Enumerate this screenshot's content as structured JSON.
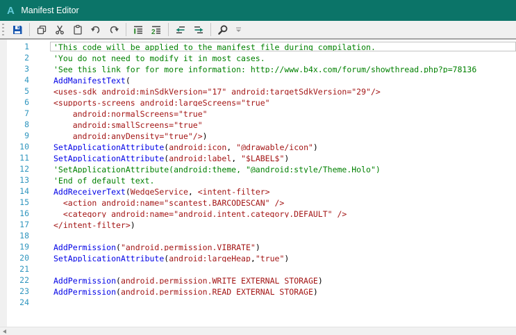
{
  "titlebar": {
    "logo": "A",
    "title": "Manifest Editor",
    "bg_color": "#0b7468",
    "logo_color": "#62cbd8"
  },
  "toolbar": {
    "items": [
      {
        "type": "grip",
        "name": "toolbar-grip"
      },
      {
        "type": "button",
        "name": "save-button",
        "icon": "save-icon"
      },
      {
        "type": "separator"
      },
      {
        "type": "button",
        "name": "copy-button",
        "icon": "copy-icon"
      },
      {
        "type": "button",
        "name": "cut-button",
        "icon": "cut-icon"
      },
      {
        "type": "button",
        "name": "paste-button",
        "icon": "paste-icon"
      },
      {
        "type": "button",
        "name": "undo-button",
        "icon": "undo-icon"
      },
      {
        "type": "button",
        "name": "redo-button",
        "icon": "redo-icon"
      },
      {
        "type": "separator"
      },
      {
        "type": "button",
        "name": "comment-button",
        "icon": "comment-icon"
      },
      {
        "type": "button",
        "name": "uncomment-button",
        "icon": "uncomment-icon"
      },
      {
        "type": "separator"
      },
      {
        "type": "button",
        "name": "outdent-button",
        "icon": "outdent-icon"
      },
      {
        "type": "button",
        "name": "indent-button",
        "icon": "indent-icon"
      },
      {
        "type": "separator"
      },
      {
        "type": "button",
        "name": "find-button",
        "icon": "search-icon"
      },
      {
        "type": "overflow",
        "name": "toolbar-overflow-button",
        "icon": "chevron-down-icon"
      }
    ]
  },
  "editor": {
    "colors": {
      "com": "#008000",
      "kw": "#0000e6",
      "str": "#a31515",
      "pl": "#000000",
      "line_number": "#2e95be",
      "current_line_border": "#c3c3c3"
    },
    "lines": [
      {
        "n": 1,
        "current": true,
        "seg": [
          {
            "t": "'This code will be applied to the manifest file during compilation.",
            "c": "com"
          }
        ]
      },
      {
        "n": 2,
        "seg": [
          {
            "t": "'You do not need to modify it in most cases.",
            "c": "com"
          }
        ]
      },
      {
        "n": 3,
        "seg": [
          {
            "t": "'See this link for for more information: http://www.b4x.com/forum/showthread.php?p=78136",
            "c": "com"
          }
        ]
      },
      {
        "n": 4,
        "seg": [
          {
            "t": "AddManifestText",
            "c": "kw"
          },
          {
            "t": "(",
            "c": "pl"
          }
        ]
      },
      {
        "n": 5,
        "seg": [
          {
            "t": "<uses-sdk android:minSdkVersion=\"17\" android:targetSdkVersion=\"29\"/>",
            "c": "str"
          }
        ]
      },
      {
        "n": 6,
        "seg": [
          {
            "t": "<supports-screens android:largeScreens=\"true\"",
            "c": "str"
          }
        ]
      },
      {
        "n": 7,
        "seg": [
          {
            "t": "    android:normalScreens=\"true\"",
            "c": "str"
          }
        ]
      },
      {
        "n": 8,
        "seg": [
          {
            "t": "    android:smallScreens=\"true\"",
            "c": "str"
          }
        ]
      },
      {
        "n": 9,
        "seg": [
          {
            "t": "    android:anyDensity=\"true\"/>",
            "c": "str"
          },
          {
            "t": ")",
            "c": "pl"
          }
        ]
      },
      {
        "n": 10,
        "seg": [
          {
            "t": "SetApplicationAttribute",
            "c": "kw"
          },
          {
            "t": "(",
            "c": "pl"
          },
          {
            "t": "android:icon",
            "c": "str"
          },
          {
            "t": ", ",
            "c": "pl"
          },
          {
            "t": "\"@drawable/icon\"",
            "c": "str"
          },
          {
            "t": ")",
            "c": "pl"
          }
        ]
      },
      {
        "n": 11,
        "seg": [
          {
            "t": "SetApplicationAttribute",
            "c": "kw"
          },
          {
            "t": "(",
            "c": "pl"
          },
          {
            "t": "android:label",
            "c": "str"
          },
          {
            "t": ", ",
            "c": "pl"
          },
          {
            "t": "\"$LABEL$\"",
            "c": "str"
          },
          {
            "t": ")",
            "c": "pl"
          }
        ]
      },
      {
        "n": 12,
        "seg": [
          {
            "t": "'SetApplicationAttribute(android:theme, \"@android:style/Theme.Holo\")",
            "c": "com"
          }
        ]
      },
      {
        "n": 13,
        "seg": [
          {
            "t": "'End of default text.",
            "c": "com"
          }
        ]
      },
      {
        "n": 14,
        "seg": [
          {
            "t": "AddReceiverText",
            "c": "kw"
          },
          {
            "t": "(",
            "c": "pl"
          },
          {
            "t": "WedgeService",
            "c": "str"
          },
          {
            "t": ", ",
            "c": "pl"
          },
          {
            "t": "<intent-filter>",
            "c": "str"
          }
        ]
      },
      {
        "n": 15,
        "seg": [
          {
            "t": "  <action android:name=\"scantest.BARCODESCAN\" />",
            "c": "str"
          }
        ]
      },
      {
        "n": 16,
        "seg": [
          {
            "t": "  <category android:name=\"android.intent.category.DEFAULT\" />",
            "c": "str"
          }
        ]
      },
      {
        "n": 17,
        "seg": [
          {
            "t": "</intent-filter>",
            "c": "str"
          },
          {
            "t": ")",
            "c": "pl"
          }
        ]
      },
      {
        "n": 18,
        "seg": []
      },
      {
        "n": 19,
        "seg": [
          {
            "t": "AddPermission",
            "c": "kw"
          },
          {
            "t": "(",
            "c": "pl"
          },
          {
            "t": "\"android.permission.VIBRATE\"",
            "c": "str"
          },
          {
            "t": ")",
            "c": "pl"
          }
        ]
      },
      {
        "n": 20,
        "seg": [
          {
            "t": "SetApplicationAttribute",
            "c": "kw"
          },
          {
            "t": "(",
            "c": "pl"
          },
          {
            "t": "android:largeHeap",
            "c": "str"
          },
          {
            "t": ",",
            "c": "pl"
          },
          {
            "t": "\"true\"",
            "c": "str"
          },
          {
            "t": ")",
            "c": "pl"
          }
        ]
      },
      {
        "n": 21,
        "seg": []
      },
      {
        "n": 22,
        "seg": [
          {
            "t": "AddPermission",
            "c": "kw"
          },
          {
            "t": "(",
            "c": "pl"
          },
          {
            "t": "android.permission.WRITE_EXTERNAL_STORAGE",
            "c": "str"
          },
          {
            "t": ")",
            "c": "pl"
          }
        ]
      },
      {
        "n": 23,
        "seg": [
          {
            "t": "AddPermission",
            "c": "kw"
          },
          {
            "t": "(",
            "c": "pl"
          },
          {
            "t": "android.permission.READ_EXTERNAL_STORAGE",
            "c": "str"
          },
          {
            "t": ")",
            "c": "pl"
          }
        ]
      },
      {
        "n": 24,
        "seg": []
      }
    ]
  },
  "scrollbar": {
    "orientation": "horizontal",
    "icon": "scroll-left-icon"
  }
}
